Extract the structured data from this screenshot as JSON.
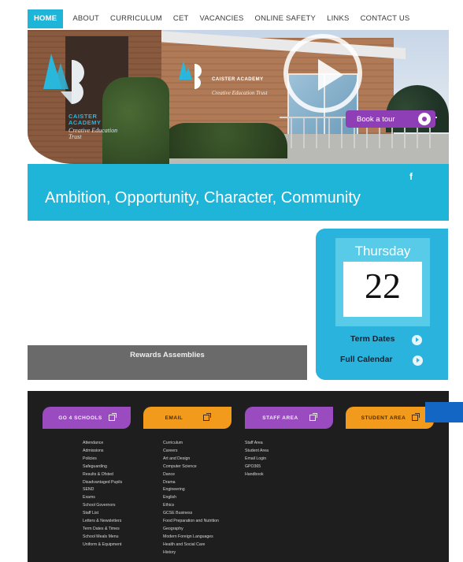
{
  "nav": {
    "items": [
      {
        "label": "HOME",
        "active": true
      },
      {
        "label": "ABOUT"
      },
      {
        "label": "CURRICULUM"
      },
      {
        "label": "CET"
      },
      {
        "label": "VACANCIES"
      },
      {
        "label": "ONLINE SAFETY"
      },
      {
        "label": "LINKS"
      },
      {
        "label": "CONTACT US"
      }
    ]
  },
  "hero": {
    "logo_text": "CAISTER ACADEMY",
    "logo_sub": "Creative Education Trust",
    "sign_text": "CAISTER ACADEMY",
    "sign_sub": "Creative Education Trust",
    "tour_label": "Book a tour"
  },
  "banner": {
    "tagline": "Ambition, Opportunity, Character, Community",
    "social_icon": "f"
  },
  "news": {
    "caption": "Rewards Assemblies"
  },
  "calendar": {
    "day": "Thursday",
    "date": "22",
    "term_dates": "Term Dates",
    "full_calendar": "Full Calendar"
  },
  "footer": {
    "quick_links": [
      {
        "label": "GO 4 SCHOOLS",
        "color": "#9a4bc0"
      },
      {
        "label": "EMAIL",
        "color": "#f29a1c"
      },
      {
        "label": "STAFF AREA",
        "color": "#9a4bc0"
      },
      {
        "label": "STUDENT AREA",
        "color": "#f29a1c"
      }
    ],
    "col1": [
      "Attendance",
      "Admissions",
      "Policies",
      "Safeguarding",
      "Results & Ofsted",
      "Disadvantaged Pupils",
      "SEND",
      "Exams",
      "School Governors",
      "Staff List",
      "Letters & Newsletters",
      "Term Dates & Times",
      "School Meals Menu",
      "Uniform & Equipment"
    ],
    "col2": [
      "Curriculum",
      "Careers",
      "Art and Design",
      "Computer Science",
      "Dance",
      "Drama",
      "Engineering",
      "English",
      "Ethics",
      "GCSE Business",
      "Food Preparation and Nutrition",
      "Geography",
      "Modern Foreign Languages",
      "Health and Social Care",
      "History"
    ],
    "col3": [
      "Staff Area",
      "Student Area",
      "Email Login",
      "GPO365",
      "Handbook"
    ]
  },
  "colors": {
    "accent_cyan": "#1fb5d9",
    "purple": "#9a4bc0",
    "orange": "#f29a1c",
    "footer_bg": "#1e1e1e"
  }
}
